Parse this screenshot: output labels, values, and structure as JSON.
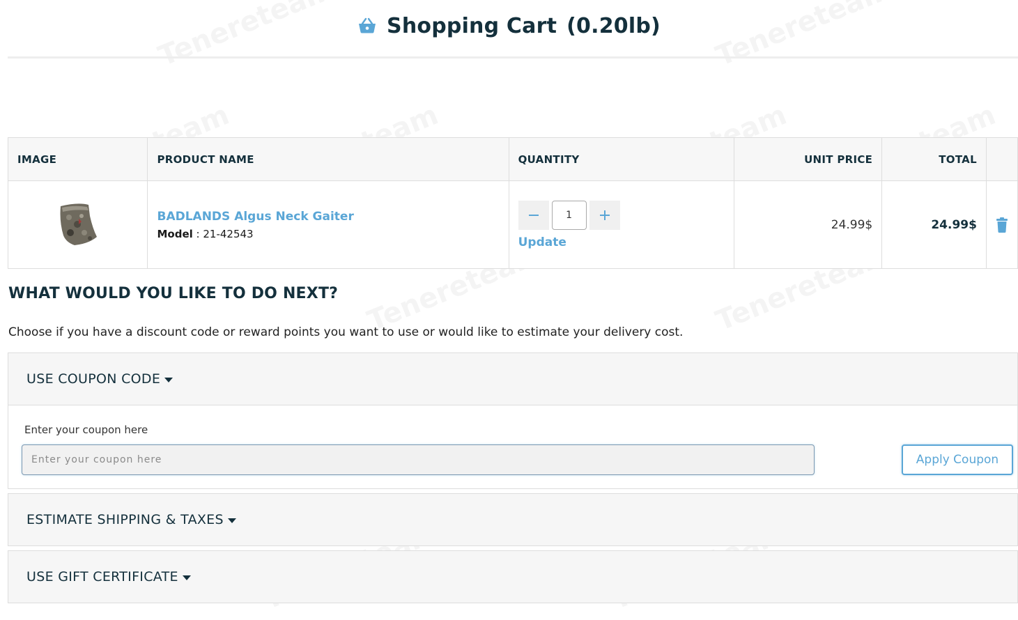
{
  "header": {
    "title": "Shopping Cart",
    "weight": "(0.20lb)",
    "icon": "basket-icon"
  },
  "cart": {
    "columns": {
      "image": "IMAGE",
      "product_name": "PRODUCT NAME",
      "quantity": "QUANTITY",
      "unit_price": "UNIT PRICE",
      "total": "TOTAL"
    },
    "items": [
      {
        "name": "BADLANDS Algus Neck Gaiter",
        "model_label": "Model",
        "model_value": "21-42543",
        "quantity": "1",
        "update_label": "Update",
        "unit_price": "24.99$",
        "total": "24.99$"
      }
    ]
  },
  "next": {
    "title": "WHAT WOULD YOU LIKE TO DO NEXT?",
    "description": "Choose if you have a discount code or reward points you want to use or would like to estimate your delivery cost."
  },
  "coupon": {
    "heading": "USE COUPON CODE",
    "label": "Enter your coupon here",
    "placeholder": "Enter your coupon here",
    "button": "Apply Coupon"
  },
  "shipping": {
    "heading": "ESTIMATE SHIPPING & TAXES"
  },
  "gift": {
    "heading": "USE GIFT CERTIFICATE"
  },
  "colors": {
    "accent": "#5aa6d6",
    "heading": "#14303c",
    "panel_bg": "#f6f6f6"
  },
  "watermark": "Tenereteam"
}
